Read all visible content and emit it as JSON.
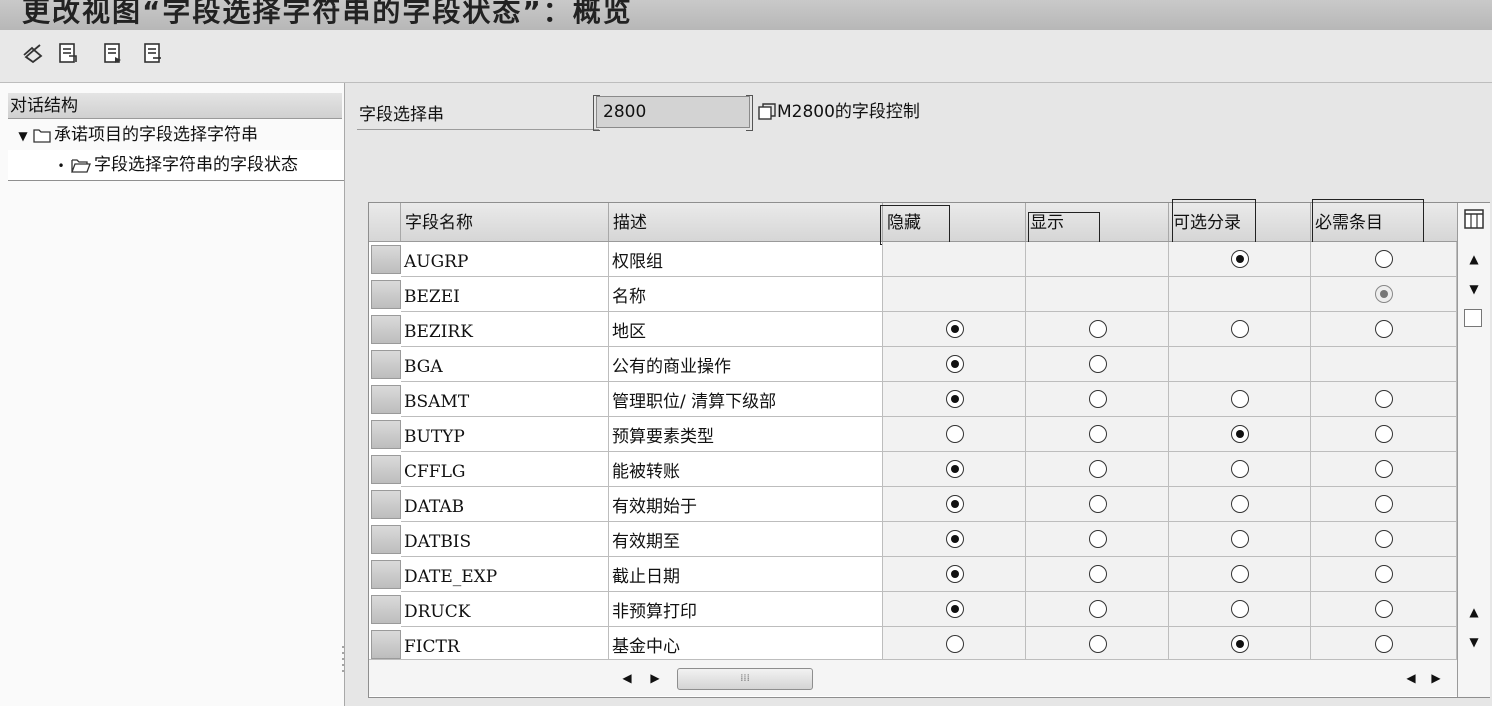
{
  "title": "更改视图“字段选择字符串的字段状态”：概览",
  "toolbar": {
    "icons": [
      "other-view-icon",
      "export-icon",
      "export-icon",
      "export-icon"
    ]
  },
  "tree": {
    "header": "对话结构",
    "items": [
      {
        "label": "承诺项目的字段选择字符串",
        "expanded": true
      },
      {
        "label": "字段选择字符串的字段状态",
        "selected": true
      }
    ]
  },
  "field_selection": {
    "label": "字段选择串",
    "value": "2800",
    "description": "M2800的字段控制"
  },
  "table": {
    "columns": [
      "字段名称",
      "描述",
      "隐藏",
      "显示",
      "可选分录",
      "必需条目"
    ],
    "rows": [
      {
        "field": "AUGRP",
        "desc": "权限组",
        "radios": [
          null,
          null,
          "on",
          "off"
        ]
      },
      {
        "field": "BEZEI",
        "desc": "名称",
        "radios": [
          null,
          null,
          null,
          "on-dis"
        ]
      },
      {
        "field": "BEZIRK",
        "desc": "地区",
        "radios": [
          "on",
          "off",
          "off",
          "off"
        ]
      },
      {
        "field": "BGA",
        "desc": "公有的商业操作",
        "radios": [
          "on",
          "off",
          null,
          null
        ]
      },
      {
        "field": "BSAMT",
        "desc": "管理职位/ 清算下级部",
        "radios": [
          "on",
          "off",
          "off",
          "off"
        ]
      },
      {
        "field": "BUTYP",
        "desc": "预算要素类型",
        "radios": [
          "off",
          "off",
          "on",
          "off"
        ]
      },
      {
        "field": "CFFLG",
        "desc": "能被转账",
        "radios": [
          "on",
          "off",
          "off",
          "off"
        ]
      },
      {
        "field": "DATAB",
        "desc": "有效期始于",
        "radios": [
          "on",
          "off",
          "off",
          "off"
        ]
      },
      {
        "field": "DATBIS",
        "desc": "有效期至",
        "radios": [
          "on",
          "off",
          "off",
          "off"
        ]
      },
      {
        "field": "DATE_EXP",
        "desc": "截止日期",
        "radios": [
          "on",
          "off",
          "off",
          "off"
        ]
      },
      {
        "field": "DRUCK",
        "desc": "非预算打印",
        "radios": [
          "on",
          "off",
          "off",
          "off"
        ]
      },
      {
        "field": "FICTR",
        "desc": "基金中心",
        "radios": [
          "off",
          "off",
          "on",
          "off"
        ]
      }
    ]
  }
}
